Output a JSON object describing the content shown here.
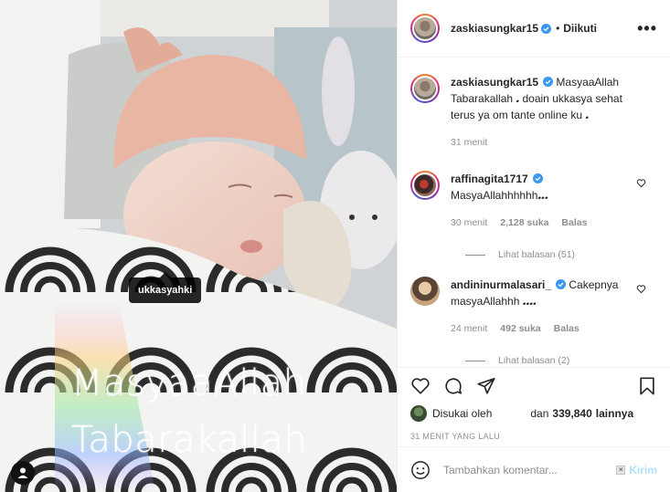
{
  "photo": {
    "tag_label": "ukkasyahki",
    "overlay_line1": "MasyaaAllah",
    "overlay_line2": "Tabarakallah"
  },
  "header": {
    "username": "zaskiasungkar15",
    "separator": "•",
    "follow_label": "Diikuti",
    "more_icon": "more-horizontal-icon"
  },
  "caption": {
    "username": "zaskiasungkar15",
    "text": "MasyaaAllah Tabarakallah 𝅘 doain ukkasya sehat terus ya om tante online ku 𝅘",
    "time": "31 menit"
  },
  "comments": [
    {
      "username": "raffinagita1717",
      "text": "MasyaAllahhhhhh𝅘𝅘𝅘",
      "time": "30 menit",
      "likes": "2,128 suka",
      "reply_label": "Balas",
      "view_replies": "Lihat balasan (51)"
    },
    {
      "username": "andininurmalasari_",
      "text": "Cakepnya masyaAllahhh 𝅘𝅘𝅘𝅘",
      "time": "24 menit",
      "likes": "492 suka",
      "reply_label": "Balas",
      "view_replies": "Lihat balasan (2)"
    }
  ],
  "likes": {
    "prefix": "Disukai oleh",
    "suffix_pre": "dan",
    "count": "339,840",
    "suffix": "lainnya"
  },
  "time_ago": "31 MENIT YANG LALU",
  "add_comment": {
    "placeholder": "Tambahkan komentar...",
    "post_label": "Kirim"
  },
  "colors": {
    "verified": "#3897f0",
    "post_disabled": "#b2dffc",
    "muted": "#8e8e8e"
  }
}
